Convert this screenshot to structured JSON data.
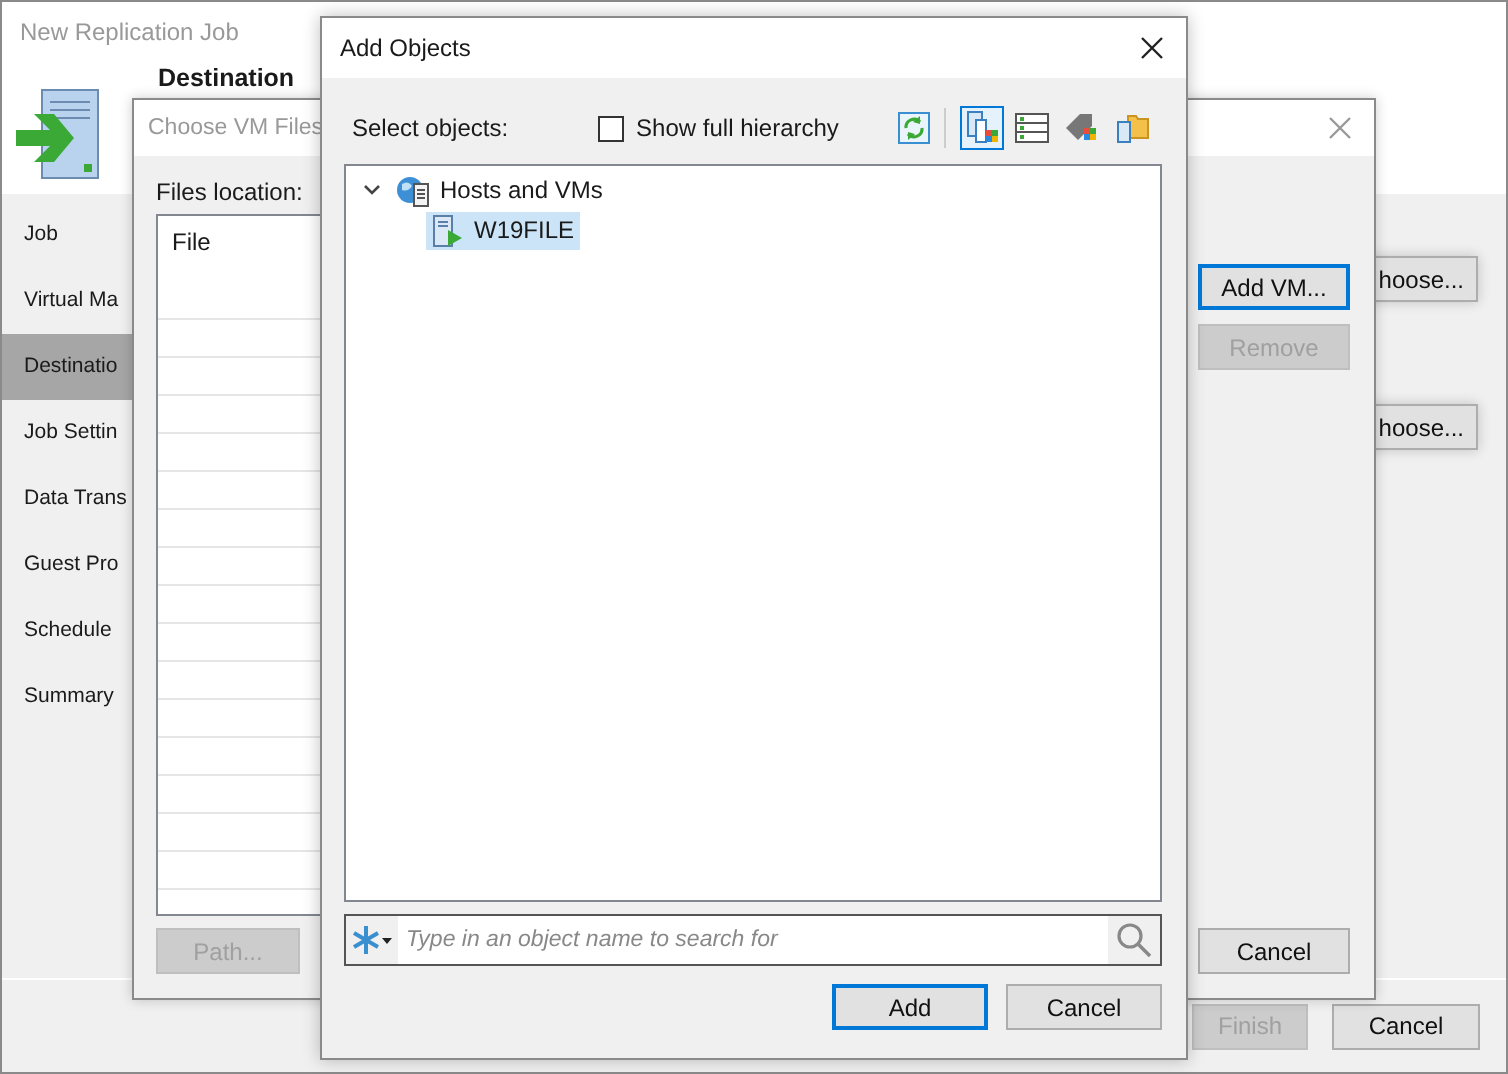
{
  "main_window": {
    "title": "New Replication Job",
    "header_title": "Destination",
    "steps": [
      {
        "label": "Job",
        "selected": false
      },
      {
        "label": "Virtual Ma",
        "selected": false
      },
      {
        "label": "Destinatio",
        "selected": true
      },
      {
        "label": "Job Settin",
        "selected": false
      },
      {
        "label": "Data Trans",
        "selected": false
      },
      {
        "label": "Guest Pro",
        "selected": false
      },
      {
        "label": "Schedule",
        "selected": false
      },
      {
        "label": "Summary",
        "selected": false
      }
    ],
    "choose_buttons": [
      "hoose...",
      "hoose..."
    ],
    "finish_button": {
      "label": "Finish",
      "disabled": true
    },
    "cancel_button": {
      "label": "Cancel",
      "disabled": false
    }
  },
  "choose_vm_files_dialog": {
    "title": "Choose VM Files",
    "files_location_label": "Files location:",
    "table": {
      "columns": [
        "File"
      ]
    },
    "path_button": {
      "label": "Path...",
      "disabled": true
    },
    "add_vm_button": {
      "label": "Add VM...",
      "disabled": false
    },
    "remove_button": {
      "label": "Remove",
      "disabled": true
    },
    "cancel_button": {
      "label": "Cancel",
      "disabled": false
    }
  },
  "add_objects_dialog": {
    "title": "Add Objects",
    "select_label": "Select objects:",
    "show_full_hierarchy": {
      "label": "Show full hierarchy",
      "checked": false
    },
    "view_buttons": [
      {
        "kind": "hierarchy",
        "selected": true
      },
      {
        "kind": "list",
        "selected": false
      },
      {
        "kind": "tags",
        "selected": false
      },
      {
        "kind": "folders",
        "selected": false
      }
    ],
    "tree": [
      {
        "label": "Hosts and VMs",
        "expanded": true,
        "selected": false,
        "children": [
          {
            "label": "W19FILE",
            "selected": true
          }
        ]
      }
    ],
    "search": {
      "placeholder": "Type in an object name to search for"
    },
    "add_button": {
      "label": "Add",
      "disabled": false
    },
    "cancel_button": {
      "label": "Cancel",
      "disabled": false
    }
  }
}
